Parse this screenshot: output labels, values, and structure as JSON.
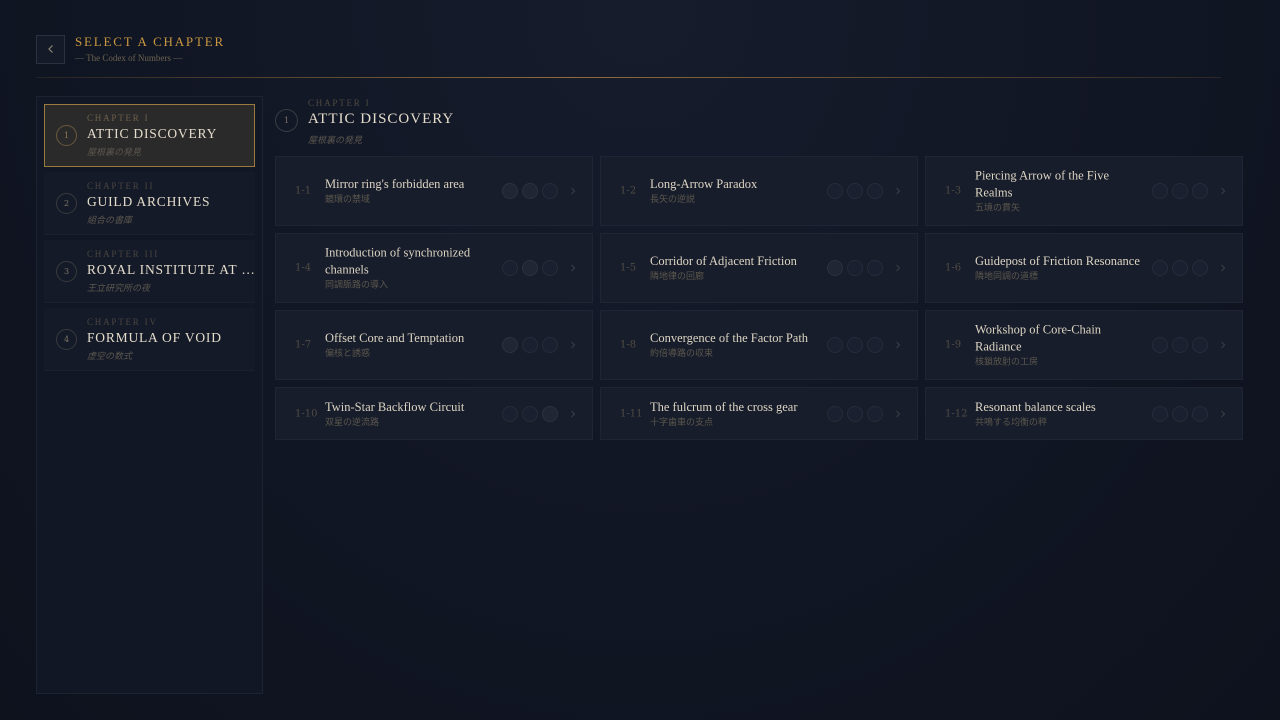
{
  "header": {
    "title": "Select a Chapter",
    "subtitle": "— The Codex of Numbers —"
  },
  "sidebar": {
    "chapters": [
      {
        "num": "1",
        "kicker": "Chapter I",
        "name": "Attic Discovery",
        "sub": "屋根裏の発見",
        "active": true
      },
      {
        "num": "2",
        "kicker": "Chapter II",
        "name": "Guild Archives",
        "sub": "組合の書庫",
        "active": false
      },
      {
        "num": "3",
        "kicker": "Chapter III",
        "name": "Royal Institute at Night",
        "sub": "王立研究所の夜",
        "active": false
      },
      {
        "num": "4",
        "kicker": "Chapter IV",
        "name": "Formula of Void",
        "sub": "虚空の数式",
        "active": false
      }
    ]
  },
  "main": {
    "num": "1",
    "kicker": "Chapter I",
    "name": "Attic Discovery",
    "sub": "屋根裏の発見",
    "stages": [
      {
        "code": "1-1",
        "title": "Mirror ring's forbidden area",
        "sub": "鏡環の禁域"
      },
      {
        "code": "1-2",
        "title": "Long-Arrow Paradox",
        "sub": "長矢の逆説"
      },
      {
        "code": "1-3",
        "title": "Piercing Arrow of the Five Realms",
        "sub": "五境の貫矢"
      },
      {
        "code": "1-4",
        "title": "Introduction of synchronized channels",
        "sub": "同調脈路の導入"
      },
      {
        "code": "1-5",
        "title": "Corridor of Adjacent Friction",
        "sub": "隣地律の回廊"
      },
      {
        "code": "1-6",
        "title": "Guidepost of Friction Resonance",
        "sub": "隣地同調の道標"
      },
      {
        "code": "1-7",
        "title": "Offset Core and Temptation",
        "sub": "偏核と誘惑"
      },
      {
        "code": "1-8",
        "title": "Convergence of the Factor Path",
        "sub": "約倍導路の収束"
      },
      {
        "code": "1-9",
        "title": "Workshop of Core-Chain Radiance",
        "sub": "核鎖放射の工房"
      },
      {
        "code": "1-10",
        "title": "Twin-Star Backflow Circuit",
        "sub": "双星の逆流路"
      },
      {
        "code": "1-11",
        "title": "The fulcrum of the cross gear",
        "sub": "十字歯車の支点"
      },
      {
        "code": "1-12",
        "title": "Resonant balance scales",
        "sub": "共鳴する均衡の秤"
      }
    ]
  },
  "icons": {
    "back": "chevron-left-icon",
    "arrow": "chevron-right-icon",
    "star": "star-slot-icon"
  },
  "colors": {
    "accent": "#c9973f",
    "active_border": "#9b7a3e",
    "background": "#111624"
  }
}
